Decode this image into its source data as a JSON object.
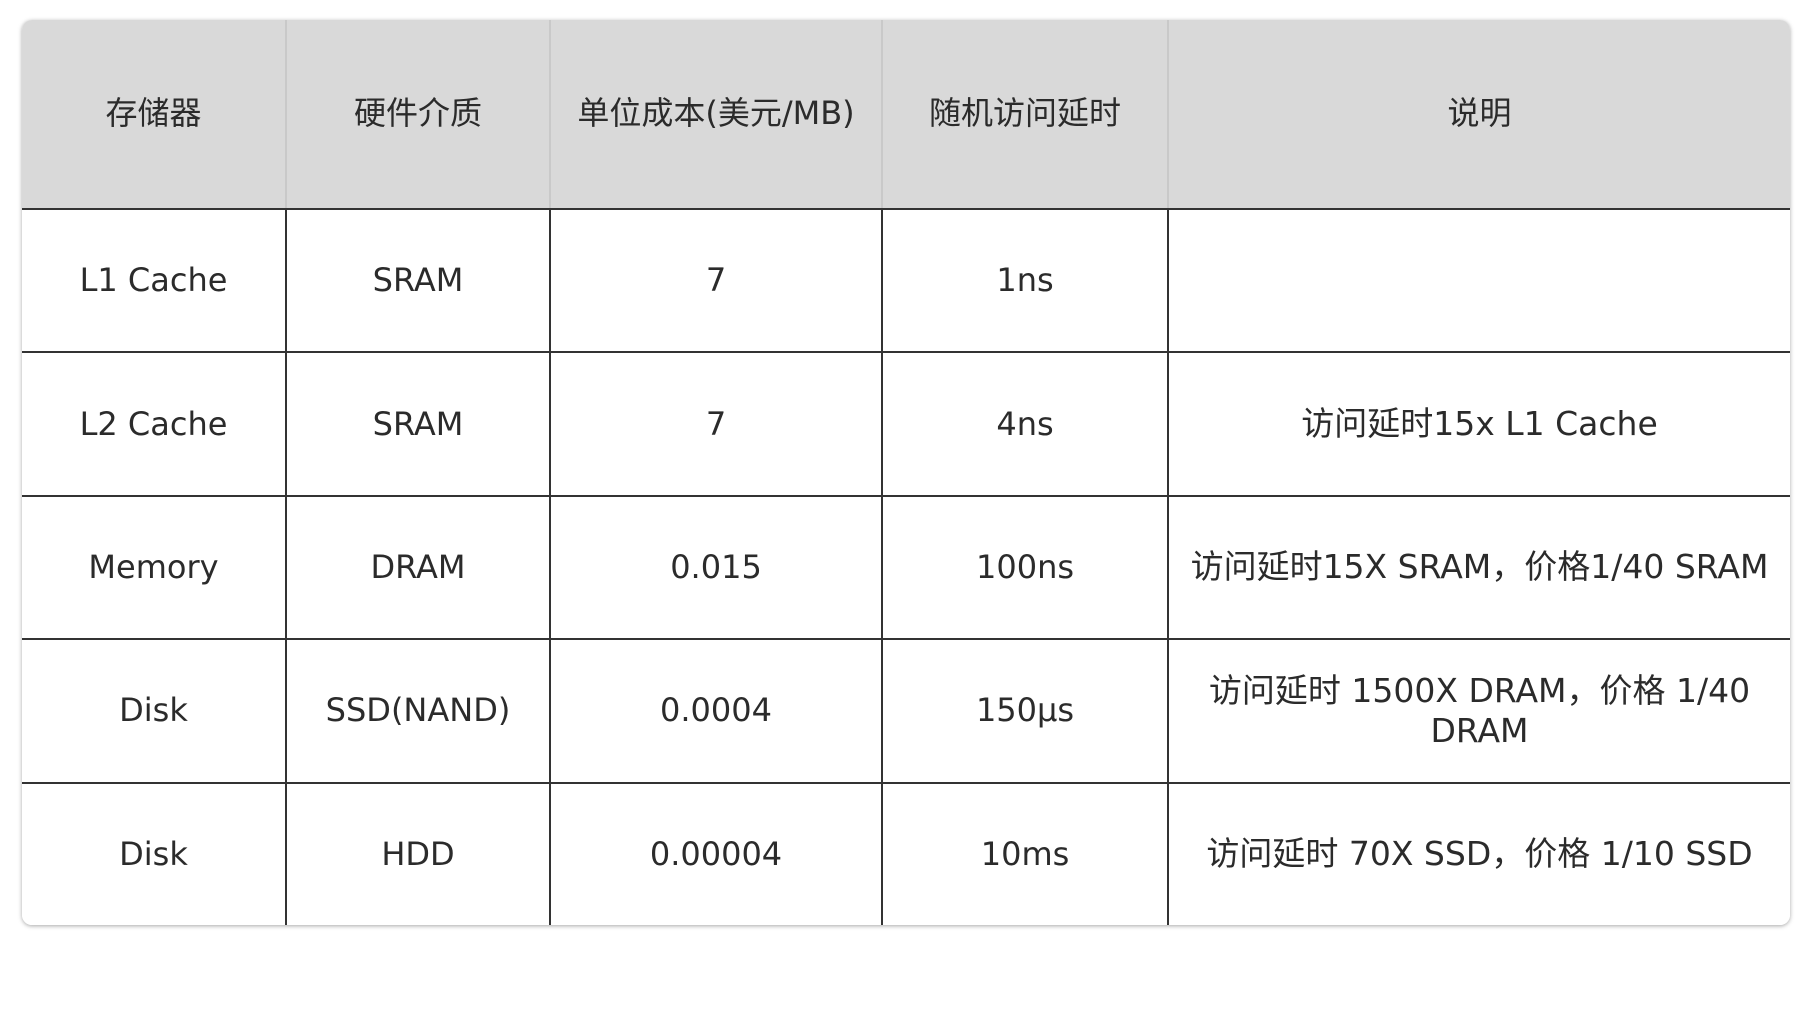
{
  "table": {
    "headers": [
      "存储器",
      "硬件介质",
      "单位成本(美元/MB)",
      "随机访问延时",
      "说明"
    ],
    "rows": [
      [
        "L1 Cache",
        "SRAM",
        "7",
        "1ns",
        ""
      ],
      [
        "L2 Cache",
        "SRAM",
        "7",
        "4ns",
        "访问延时15x L1 Cache"
      ],
      [
        "Memory",
        "DRAM",
        "0.015",
        "100ns",
        "访问延时15X SRAM，价格1/40 SRAM"
      ],
      [
        "Disk",
        "SSD(NAND)",
        "0.0004",
        "150μs",
        "访问延时 1500X DRAM，价格 1/40 DRAM"
      ],
      [
        "Disk",
        "HDD",
        "0.00004",
        "10ms",
        "访问延时 70X SSD，价格 1/10 SSD"
      ]
    ]
  }
}
